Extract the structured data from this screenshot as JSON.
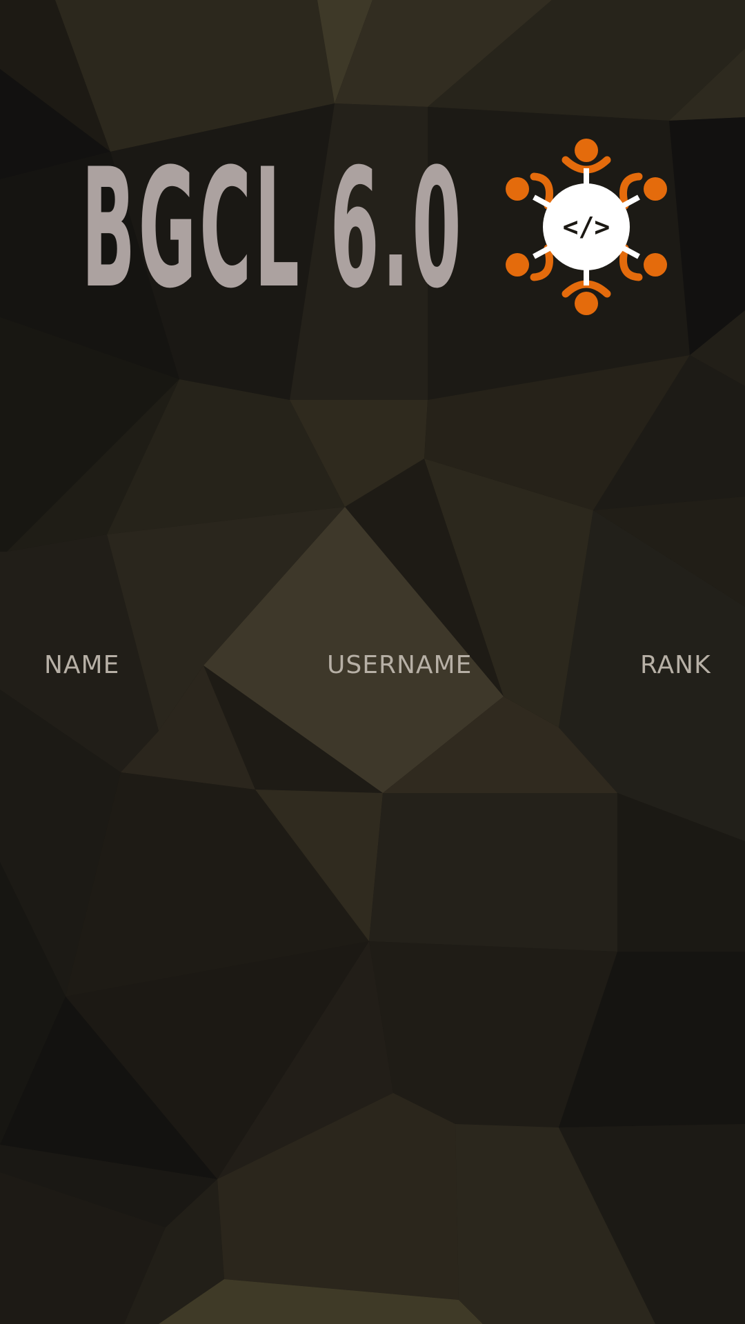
{
  "app": {
    "title": "BGCL 6.0",
    "logo_icon": "community-code-icon",
    "logo_code_glyph": "</>",
    "accent_color": "#e46b0c",
    "title_color": "#aca2a0"
  },
  "leaderboard": {
    "columns": [
      {
        "label": "NAME"
      },
      {
        "label": "USERNAME"
      },
      {
        "label": "RANK"
      }
    ],
    "rows": []
  },
  "background": {
    "style": "low-poly",
    "base_color": "#1e1b15",
    "highlight_color": "#403a29"
  }
}
